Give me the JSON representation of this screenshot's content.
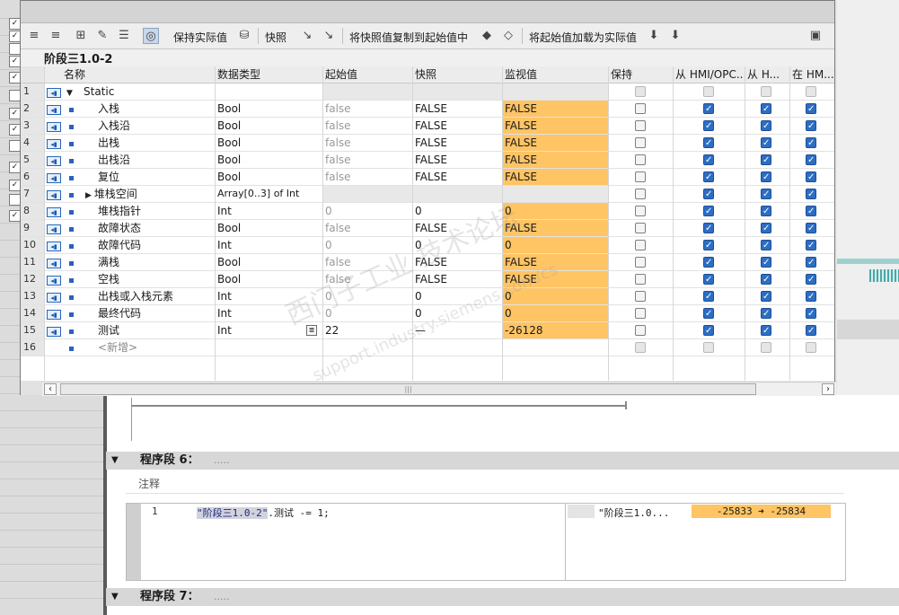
{
  "toolbar": {
    "keep_actual": "保持实际值",
    "snapshot": "快照",
    "copy_snapshot_to_start": "将快照值复制到起始值中",
    "load_start_as_actual": "将起始值加载为实际值"
  },
  "block_title": "阶段三1.0-2",
  "columns": {
    "name": "名称",
    "type": "数据类型",
    "start": "起始值",
    "snapshot": "快照",
    "monitor": "监视值",
    "retain": "保持",
    "hmi1": "从 HMI/OPC..",
    "hmi2": "从 H...",
    "hmi3": "在 HM..."
  },
  "rows": [
    {
      "num": "1",
      "name": "Static",
      "type": "",
      "start": "",
      "snap": "",
      "mon": "",
      "ret": false,
      "h1": false,
      "h2": false,
      "h3": false
    },
    {
      "num": "2",
      "name": "入栈",
      "type": "Bool",
      "start": "false",
      "snap": "FALSE",
      "mon": "FALSE",
      "ret": false,
      "h1": true,
      "h2": true,
      "h3": true
    },
    {
      "num": "3",
      "name": "入栈沿",
      "type": "Bool",
      "start": "false",
      "snap": "FALSE",
      "mon": "FALSE",
      "ret": false,
      "h1": true,
      "h2": true,
      "h3": true
    },
    {
      "num": "4",
      "name": "出栈",
      "type": "Bool",
      "start": "false",
      "snap": "FALSE",
      "mon": "FALSE",
      "ret": false,
      "h1": true,
      "h2": true,
      "h3": true
    },
    {
      "num": "5",
      "name": "出栈沿",
      "type": "Bool",
      "start": "false",
      "snap": "FALSE",
      "mon": "FALSE",
      "ret": false,
      "h1": true,
      "h2": true,
      "h3": true
    },
    {
      "num": "6",
      "name": "复位",
      "type": "Bool",
      "start": "false",
      "snap": "FALSE",
      "mon": "FALSE",
      "ret": false,
      "h1": true,
      "h2": true,
      "h3": true
    },
    {
      "num": "7",
      "name": "堆栈空间",
      "type": "Array[0..3] of Int",
      "start": "",
      "snap": "",
      "mon": "",
      "ret": false,
      "h1": true,
      "h2": true,
      "h3": true
    },
    {
      "num": "8",
      "name": "堆栈指针",
      "type": "Int",
      "start": "0",
      "snap": "0",
      "mon": "0",
      "ret": false,
      "h1": true,
      "h2": true,
      "h3": true
    },
    {
      "num": "9",
      "name": "故障状态",
      "type": "Bool",
      "start": "false",
      "snap": "FALSE",
      "mon": "FALSE",
      "ret": false,
      "h1": true,
      "h2": true,
      "h3": true
    },
    {
      "num": "10",
      "name": "故障代码",
      "type": "Int",
      "start": "0",
      "snap": "0",
      "mon": "0",
      "ret": false,
      "h1": true,
      "h2": true,
      "h3": true
    },
    {
      "num": "11",
      "name": "满栈",
      "type": "Bool",
      "start": "false",
      "snap": "FALSE",
      "mon": "FALSE",
      "ret": false,
      "h1": true,
      "h2": true,
      "h3": true
    },
    {
      "num": "12",
      "name": "空栈",
      "type": "Bool",
      "start": "false",
      "snap": "FALSE",
      "mon": "FALSE",
      "ret": false,
      "h1": true,
      "h2": true,
      "h3": true
    },
    {
      "num": "13",
      "name": "出栈或入栈元素",
      "type": "Int",
      "start": "0",
      "snap": "0",
      "mon": "0",
      "ret": false,
      "h1": true,
      "h2": true,
      "h3": true
    },
    {
      "num": "14",
      "name": "最终代码",
      "type": "Int",
      "start": "0",
      "snap": "0",
      "mon": "0",
      "ret": false,
      "h1": true,
      "h2": true,
      "h3": true
    },
    {
      "num": "15",
      "name": "测试",
      "type": "Int",
      "start": "22",
      "snap": "—",
      "mon": "-26128",
      "ret": false,
      "h1": true,
      "h2": true,
      "h3": true
    },
    {
      "num": "16",
      "name": "<新增>",
      "type": "",
      "start": "",
      "snap": "",
      "mon": "",
      "ret": false,
      "h1": false,
      "h2": false,
      "h3": false
    }
  ],
  "segment6": {
    "title": "程序段 6：",
    "dots": ".....",
    "comment": "注释"
  },
  "segment7": {
    "title": "程序段 7：",
    "dots": "....."
  },
  "code": {
    "line_no": "1",
    "var": "\"阶段三1.0-2\"",
    "rest": ".测试 -= 1;",
    "monitor_name": "\"阶段三1.0...",
    "monitor_value": "-25833 ➜ -25834"
  },
  "watermark": {
    "main": "西门子工业 技术论坛",
    "sub": "support.industry.siemens.com/cs"
  },
  "colors": {
    "monitor_bg": "#ffc464",
    "checkbox": "#2d6ec4"
  }
}
